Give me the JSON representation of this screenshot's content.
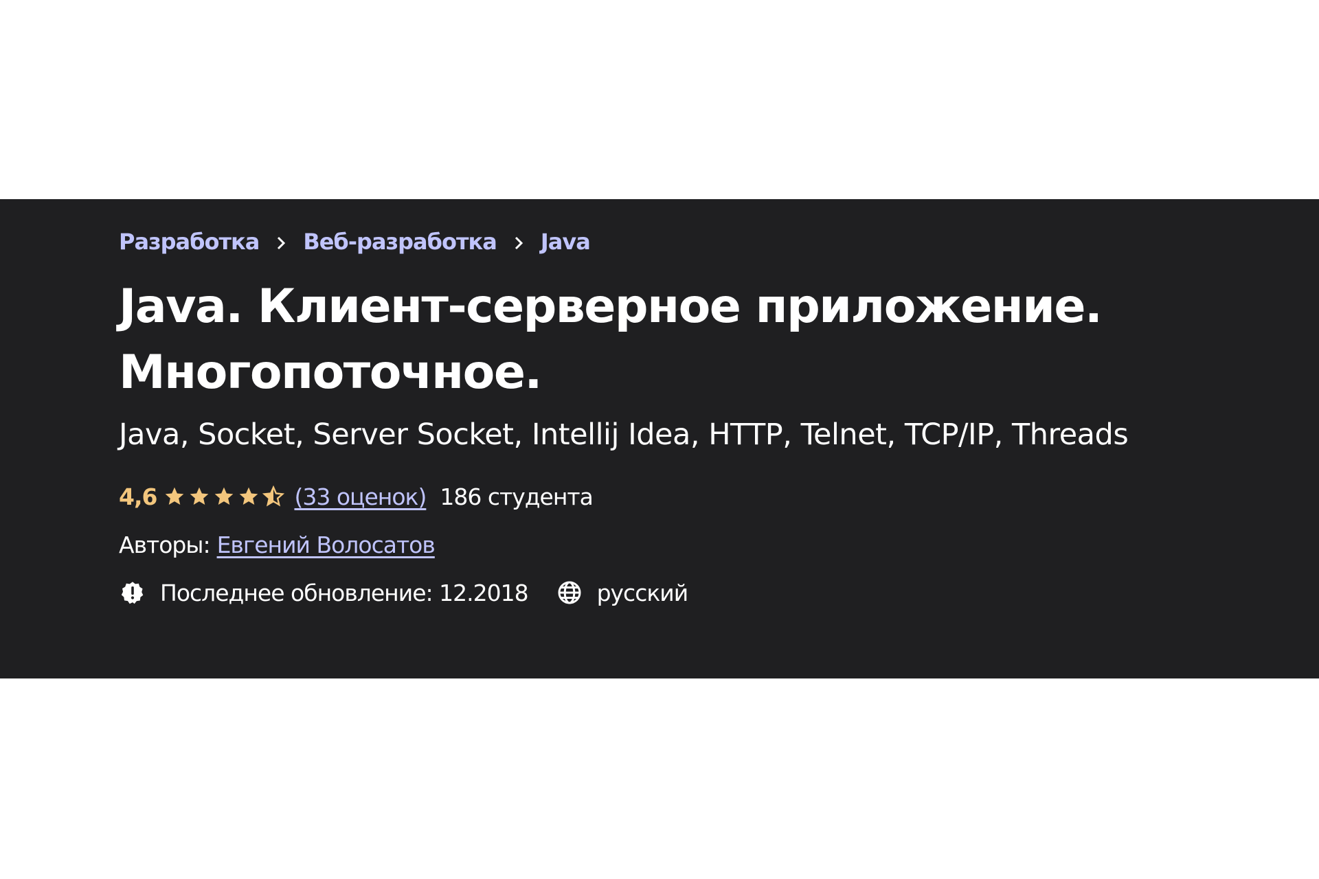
{
  "breadcrumb": {
    "items": [
      "Разработка",
      "Веб-разработка",
      "Java"
    ]
  },
  "course": {
    "title_line1": "Java. Клиент-серверное приложение.",
    "title_line2": "Многопоточное.",
    "subtitle": "Java, Socket, Server Socket, Intellij Idea, HTTP, Telnet, TCP/IP, Threads"
  },
  "rating": {
    "value": "4,6",
    "stars": 4.6,
    "count_label": "(33 оценок)",
    "students": "186 студента"
  },
  "authors": {
    "label": "Авторы:",
    "name": "Евгений Волосатов"
  },
  "meta": {
    "update_label": "Последнее обновление: 12.2018",
    "language": "русский",
    "update_icon": "alert-badge-icon",
    "language_icon": "globe-icon"
  },
  "colors": {
    "banner_bg": "#1f1f21",
    "link": "#c0c4fc",
    "rating": "#f3c67d",
    "text": "#ffffff"
  }
}
